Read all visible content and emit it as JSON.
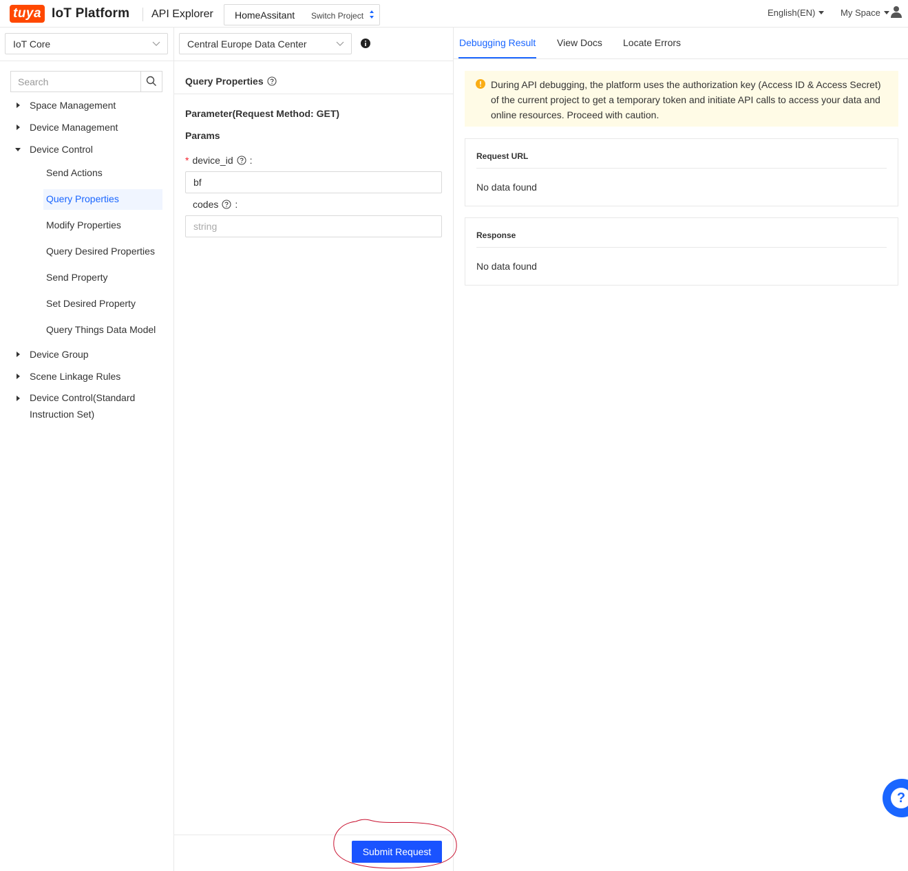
{
  "header": {
    "logo_text": "tuya",
    "brand": "IoT Platform",
    "app_title": "API Explorer",
    "project_name": "HomeAssitant",
    "switch_project": "Switch Project",
    "language": "English(EN)",
    "my_space": "My Space"
  },
  "sidebar": {
    "service_select": "IoT Core",
    "search_placeholder": "Search",
    "tree": [
      {
        "label": "Space Management",
        "expanded": false
      },
      {
        "label": "Device Management",
        "expanded": false
      },
      {
        "label": "Device Control",
        "expanded": true
      },
      {
        "label": "Device Group",
        "expanded": false
      },
      {
        "label": "Scene Linkage Rules",
        "expanded": false
      },
      {
        "label": "Device Control(Standard Instruction Set)",
        "expanded": false
      }
    ],
    "device_control_children": [
      "Send Actions",
      "Query Properties",
      "Modify Properties",
      "Query Desired Properties",
      "Send Property",
      "Set Desired Property",
      "Query Things Data Model"
    ],
    "active_child": "Query Properties"
  },
  "middle": {
    "datacenter_select": "Central Europe Data Center",
    "api_title": "Query Properties",
    "parameter_title": "Parameter(Request Method: GET)",
    "params_title": "Params",
    "fields": [
      {
        "name": "device_id",
        "required": true,
        "value": "bf",
        "placeholder": ""
      },
      {
        "name": "codes",
        "required": false,
        "value": "",
        "placeholder": "string"
      }
    ],
    "colon": ":",
    "submit_label": "Submit Request"
  },
  "right": {
    "tabs": [
      "Debugging Result",
      "View Docs",
      "Locate Errors"
    ],
    "active_tab": "Debugging Result",
    "alert_text": "During API debugging, the platform uses the authorization key (Access ID & Access Secret) of the current project to get a temporary token and initiate API calls to access your data and online resources. Proceed with caution.",
    "request_url_title": "Request URL",
    "request_url_body": "No data found",
    "response_title": "Response",
    "response_body": "No data found"
  },
  "colors": {
    "brand_orange": "#ff4800",
    "accent_blue": "#1a66ff",
    "button_blue": "#1a53ff",
    "alert_bg": "#fffbe6",
    "alert_icon": "#faad14",
    "required_red": "#f5222d",
    "annotation_red": "#c8102e"
  },
  "help_fab": "?"
}
